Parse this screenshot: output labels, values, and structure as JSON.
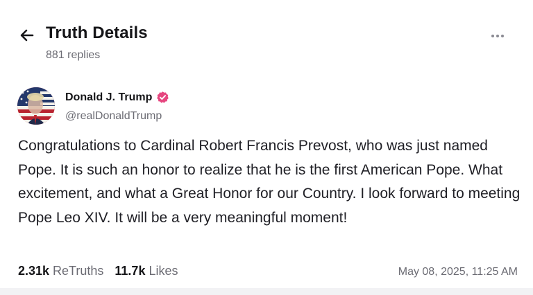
{
  "header": {
    "title": "Truth Details",
    "replies": "881 replies"
  },
  "author": {
    "name": "Donald J. Trump",
    "handle": "@realDonaldTrump",
    "verified_color": "#e6467f"
  },
  "post": {
    "text": "Congratulations to Cardinal Robert Francis Prevost, who was just named Pope. It is such an honor to realize that he is the first American Pope. What excitement, and what a Great Honor for our Country. I look forward to meeting Pope Leo XIV. It will be a very meaningful moment!",
    "retruths_count": "2.31k",
    "retruths_label": "ReTruths",
    "likes_count": "11.7k",
    "likes_label": "Likes",
    "timestamp": "May 08, 2025, 11:25 AM"
  },
  "icons": {
    "back": "arrow-left-icon",
    "more": "more-horizontal-icon",
    "verified": "verified-badge-icon"
  },
  "colors": {
    "background": "#ffffff",
    "muted_text": "#6b6b73",
    "primary_text": "#151518",
    "verified_badge": "#e6467f"
  }
}
